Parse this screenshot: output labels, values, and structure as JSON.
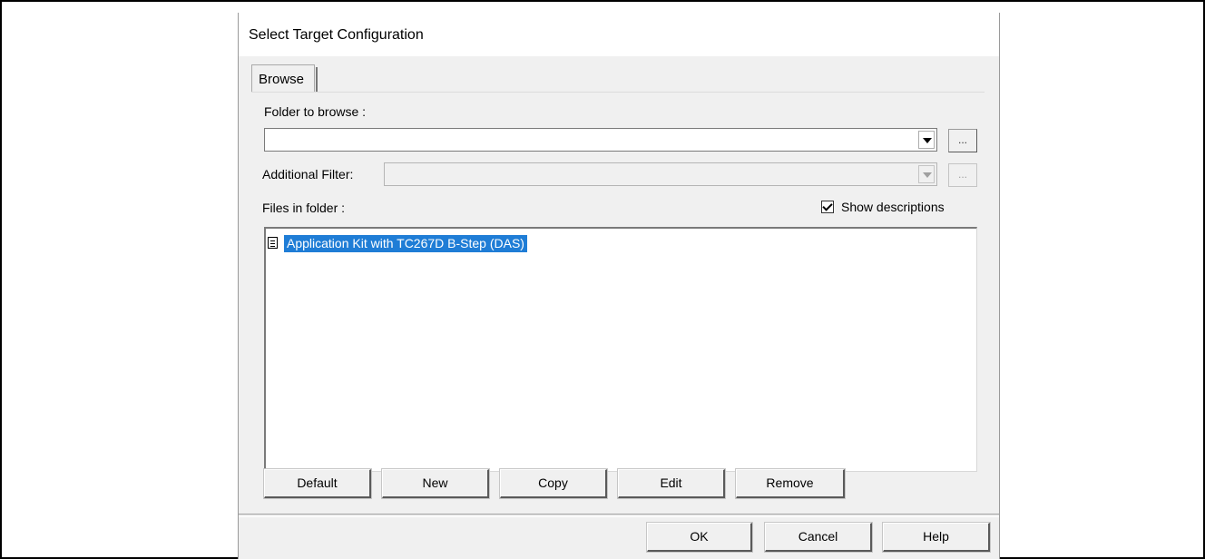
{
  "dialog": {
    "title": "Select Target Configuration",
    "tab_label": "Browse",
    "folder_label": "Folder to browse :",
    "folder_value": "",
    "folder_browse_label": "...",
    "filter_label": "Additional Filter:",
    "filter_value": "",
    "filter_browse_label": "...",
    "files_label": "Files in folder :",
    "show_descriptions": {
      "label": "Show descriptions",
      "checked": true
    },
    "files": [
      {
        "name": "Application Kit with TC267D B-Step (DAS)",
        "selected": true
      }
    ],
    "action_buttons": {
      "default": "Default",
      "new": "New",
      "copy": "Copy",
      "edit": "Edit",
      "remove": "Remove"
    },
    "footer_buttons": {
      "ok": "OK",
      "cancel": "Cancel",
      "help": "Help"
    }
  },
  "colors": {
    "selection": "#1f7dd6",
    "dialog_bg": "#f0f0f0"
  }
}
